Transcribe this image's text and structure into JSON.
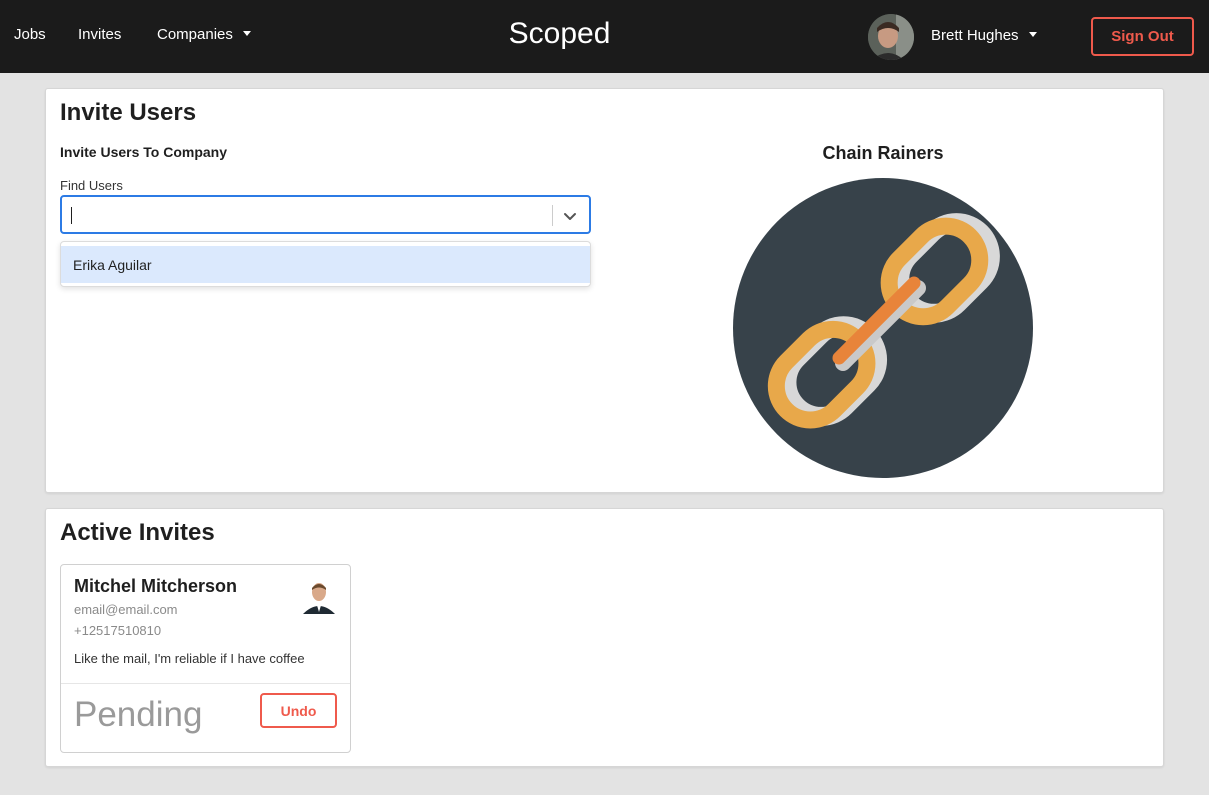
{
  "nav": {
    "links": [
      {
        "label": "Jobs"
      },
      {
        "label": "Invites"
      },
      {
        "label": "Companies"
      }
    ],
    "brand": "Scoped",
    "user_name": "Brett Hughes",
    "sign_out_label": "Sign Out"
  },
  "invite_panel": {
    "title": "Invite Users",
    "subtitle": "Invite Users To Company",
    "find_users_label": "Find Users",
    "search_value": "",
    "dropdown_options": [
      "Erika Aguilar"
    ],
    "company_name": "Chain Rainers"
  },
  "active_panel": {
    "title": "Active Invites",
    "invites": [
      {
        "name": "Mitchel Mitcherson",
        "email": "email@email.com",
        "phone": "+12517510810",
        "bio": "Like the mail, I'm reliable if I have coffee",
        "status": "Pending",
        "undo_label": "Undo"
      }
    ]
  },
  "colors": {
    "nav_bg": "#1b1b1b",
    "accent_red": "#ef5a4c",
    "focus_blue": "#2c7be5",
    "option_highlight": "#dbe9fd",
    "logo_circle": "#37424a",
    "chain_gold": "#e8a84a",
    "chain_silver": "#d8d8d8",
    "chain_orange": "#e8843a"
  }
}
